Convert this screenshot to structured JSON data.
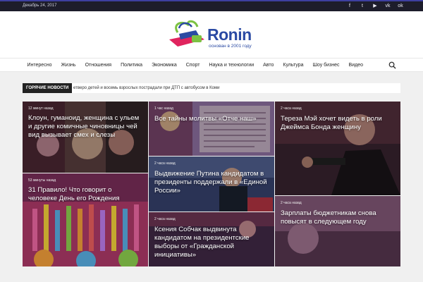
{
  "topbar": {
    "date": "Декабрь 24, 2017",
    "social": [
      {
        "icon": "facebook-icon",
        "glyph": "f"
      },
      {
        "icon": "twitter-icon",
        "glyph": "t"
      },
      {
        "icon": "youtube-icon",
        "glyph": "▶"
      },
      {
        "icon": "vk-icon",
        "glyph": "vk"
      },
      {
        "icon": "odnoklassniki-icon",
        "glyph": "ok"
      }
    ]
  },
  "logo": {
    "name": "Ronin",
    "tagline": "основан в 2001 году",
    "colors": {
      "brand": "#2b4aa3",
      "accent": "#e0245e",
      "wing": "#7cc242"
    }
  },
  "nav": {
    "items": [
      "Интересно",
      "Жизнь",
      "Отношения",
      "Политика",
      "Экономика",
      "Спорт",
      "Наука и технологии",
      "Авто",
      "Культура",
      "Шоу бизнес",
      "Видео"
    ],
    "search_icon": "search-icon"
  },
  "ticker": {
    "label": "ГОРЯЧИЕ НОВОСТИ",
    "text": "етверо детей и восемь взрослых пострадали при ДТП с автобусом в Коми"
  },
  "tiles": [
    {
      "time": "12 минут назад",
      "title": "Клоун, гуманоид, женщина с ульем и другие комичные чиновницы чей вид вызывает смех и слезы"
    },
    {
      "time": "1 час назад",
      "title": "Все тайны молитвы «Отче наш»"
    },
    {
      "time": "2 часа назад",
      "title": "Тереза Мэй хочет видеть в роли Джеймса Бонда женщину"
    },
    {
      "time": "53 минуты назад",
      "title": "31 Правило! Что говорит о человеке День его Рождения"
    },
    {
      "time": "2 часа назад",
      "title": "Выдвижение Путина кандидатом в президенты поддержали в «Единой России»"
    },
    {
      "time": "2 часа назад",
      "title": "Зарплаты бюджетникам снова повысят в следующем году"
    },
    {
      "time": "2 часа назад",
      "title": "Ксения Собчак выдвинута кандидатом на президентские выборы от «Гражданской инициативы»"
    }
  ]
}
